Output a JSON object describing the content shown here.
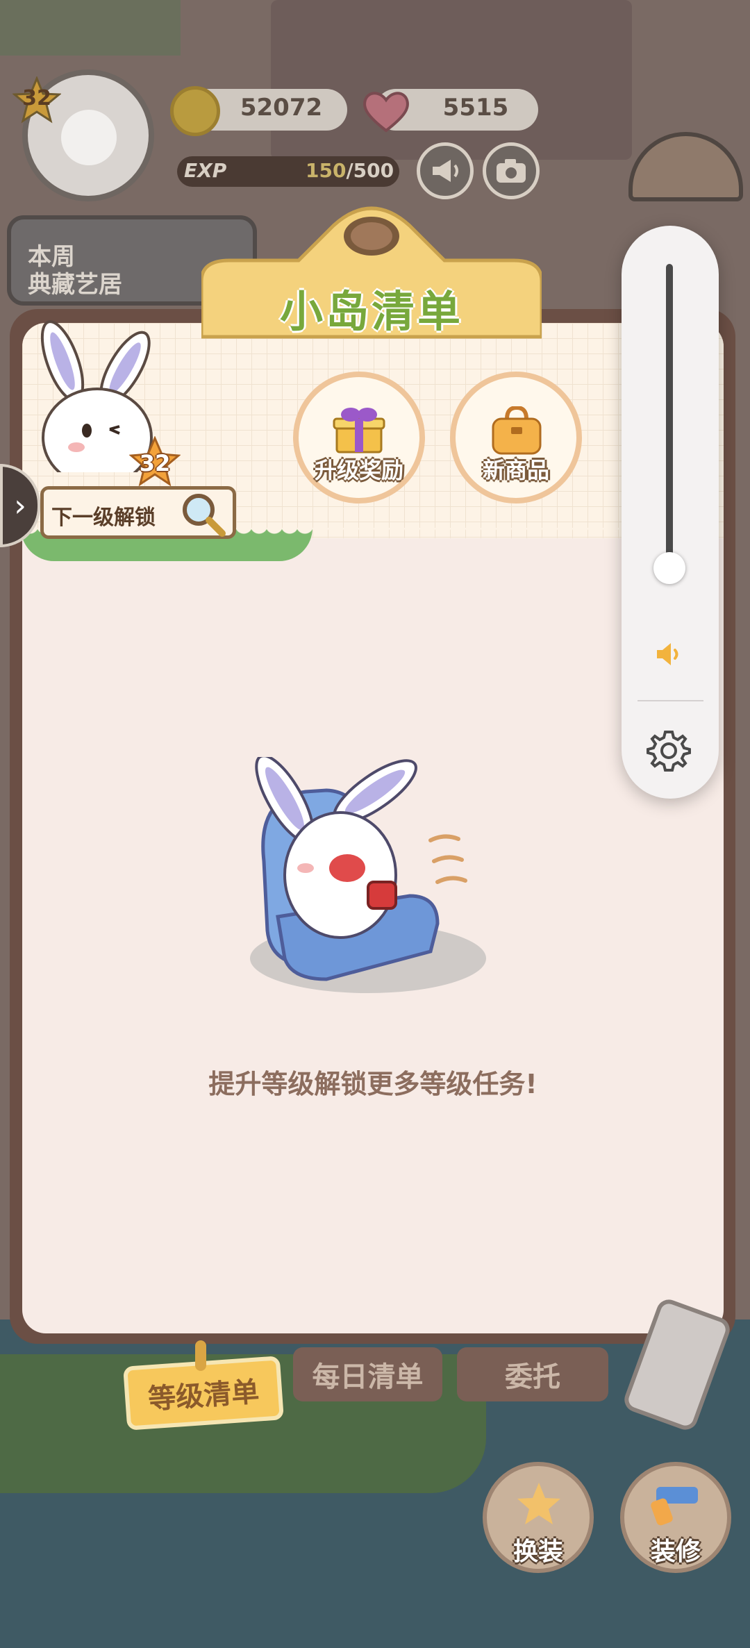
{
  "hud": {
    "player_level": "32",
    "coins": "52072",
    "hearts": "5515",
    "exp_label": "EXP",
    "exp_current": "150",
    "exp_max": "/500",
    "weekly_banner": "本周\n典藏艺居"
  },
  "panel": {
    "title": "小岛清单",
    "next_level_unlock": "下一级解锁",
    "next_level": "32",
    "rewards": [
      {
        "label": "升级奖励",
        "icon": "gift-box-icon"
      },
      {
        "label": "新商品",
        "icon": "new-item-bag-icon"
      }
    ],
    "empty_message": "提升等级解锁更多等级任务!"
  },
  "tabs": [
    {
      "label": "等级清单",
      "active": true
    },
    {
      "label": "每日清单",
      "active": false
    },
    {
      "label": "委托",
      "active": false
    }
  ],
  "bottom_buttons": [
    {
      "label": "换装",
      "icon": "outfit-icon"
    },
    {
      "label": "装修",
      "icon": "renovate-icon"
    }
  ],
  "volume_overlay": {
    "level": 0.05,
    "speaker_icon": "speaker-icon",
    "settings_icon": "gear-icon"
  },
  "colors": {
    "accent_yellow": "#f7c85c",
    "title_green": "#78a83c",
    "panel_brown": "#6b4f45"
  }
}
